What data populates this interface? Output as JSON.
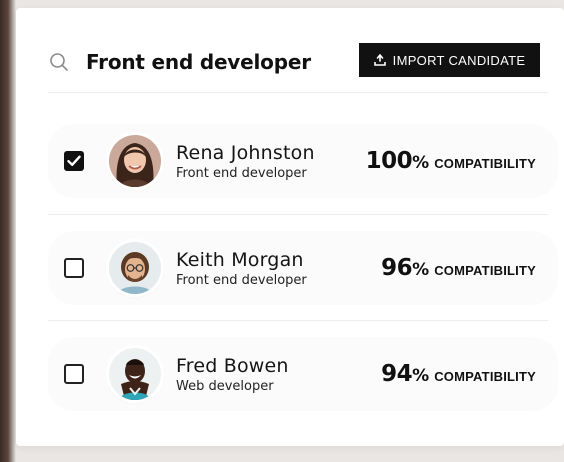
{
  "search": {
    "icon": "search-icon",
    "value": "Front end developer"
  },
  "import_button": {
    "icon": "upload-icon",
    "label": "IMPORT CANDIDATE"
  },
  "compat_label": "COMPATIBILITY",
  "candidates": [
    {
      "name": "Rena Johnston",
      "role": "Front end developer",
      "score": "100",
      "percent": "%",
      "checked": true,
      "avatar": "avatar-woman"
    },
    {
      "name": "Keith Morgan",
      "role": "Front end developer",
      "score": "96",
      "percent": "%",
      "checked": false,
      "avatar": "avatar-man-glasses"
    },
    {
      "name": "Fred Bowen",
      "role": "Web developer",
      "score": "94",
      "percent": "%",
      "checked": false,
      "avatar": "avatar-man-smiling"
    }
  ],
  "colors": {
    "button_bg": "#111111",
    "text": "#111111",
    "divider": "#ececec"
  }
}
